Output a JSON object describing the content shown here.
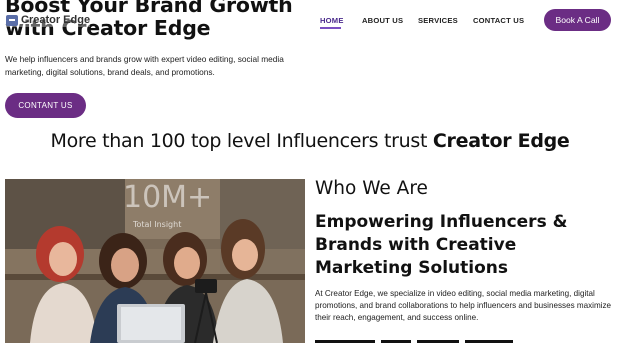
{
  "logo": {
    "text": "Creator Edge"
  },
  "nav": {
    "items": [
      {
        "label": "HOME",
        "active": true
      },
      {
        "label": "ABOUT US",
        "active": false
      },
      {
        "label": "SERVICES",
        "active": false
      },
      {
        "label": "CONTACT US",
        "active": false
      }
    ],
    "book_label": "Book A Call"
  },
  "hero": {
    "title": "Boost Your Brand Growth with Creator Edge",
    "description": "We help influencers and brands grow with expert video editing, social media marketing, digital solutions, brand deals, and promotions.",
    "cta_label": "CONTANT US"
  },
  "trust": {
    "prefix": "More than 100 top level Influencers trust ",
    "brand": "Creator Edge"
  },
  "photo": {
    "overlay_big": "10M+",
    "overlay_small": "Total Insight"
  },
  "about": {
    "title": "Who We Are",
    "subtitle": "Empowering Influencers & Brands with Creative Marketing Solutions",
    "description": "At Creator Edge, we specialize in video editing, social media marketing, digital promotions, and brand collaborations to help influencers and businesses maximize their reach, engagement, and success online."
  },
  "colors": {
    "accent": "#6b2d84",
    "nav_active": "#4a2a8c",
    "underline": "#7a4fc2"
  }
}
